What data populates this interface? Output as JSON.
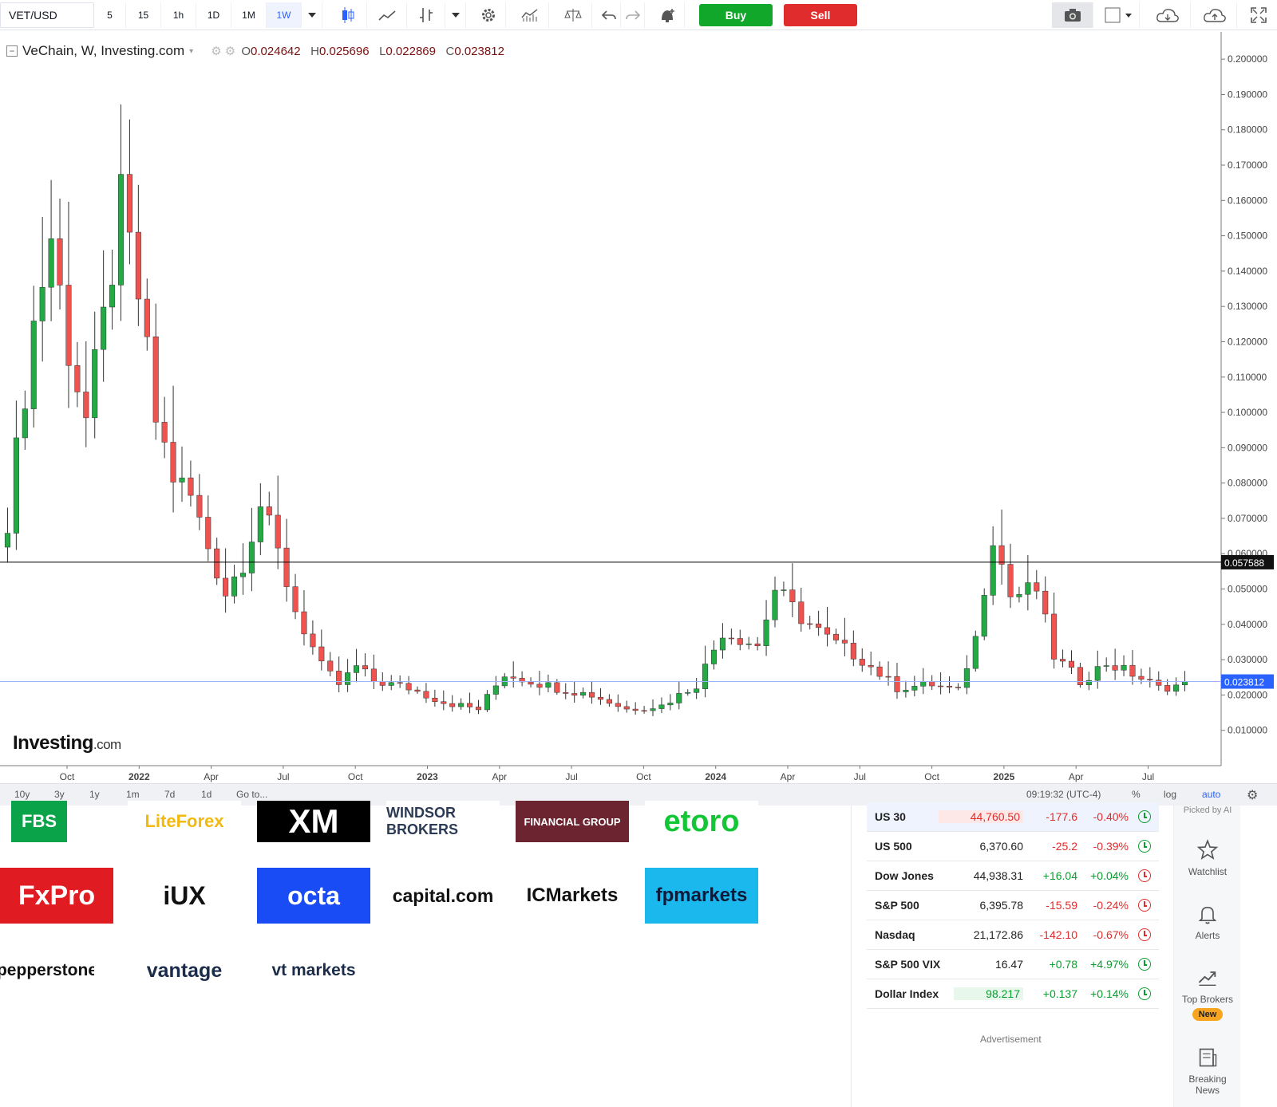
{
  "toolbar": {
    "symbol": "VET/USD",
    "intervals": [
      "5",
      "15",
      "1h",
      "1D",
      "1M",
      "1W"
    ],
    "active_interval": "1W",
    "buy_label": "Buy",
    "sell_label": "Sell"
  },
  "legend": {
    "title": "VeChain, W, Investing.com",
    "open_label": "O",
    "open": "0.024642",
    "high_label": "H",
    "high": "0.025696",
    "low_label": "L",
    "low": "0.022869",
    "close_label": "C",
    "close": "0.023812"
  },
  "chart_data": {
    "type": "candlestick",
    "title": "VeChain, W, Investing.com",
    "y_axis_ticks": [
      "0.200000",
      "0.190000",
      "0.180000",
      "0.170000",
      "0.160000",
      "0.150000",
      "0.140000",
      "0.130000",
      "0.120000",
      "0.110000",
      "0.100000",
      "0.090000",
      "0.080000",
      "0.070000",
      "0.060000",
      "0.050000",
      "0.040000",
      "0.030000",
      "0.020000",
      "0.010000"
    ],
    "ylim": [
      0.0,
      0.205
    ],
    "x_axis_ticks": [
      "Oct",
      "2022",
      "Apr",
      "Jul",
      "Oct",
      "2023",
      "Apr",
      "Jul",
      "Oct",
      "2024",
      "Apr",
      "Jul",
      "Oct",
      "2025",
      "Apr",
      "Jul"
    ],
    "horizontal_line": {
      "value": 0.057588,
      "label": "0.057588"
    },
    "last_price": {
      "value": 0.023812,
      "label": "0.023812"
    },
    "price_path": [
      [
        0,
        0.07
      ],
      [
        3,
        0.125
      ],
      [
        5,
        0.15
      ],
      [
        7,
        0.118
      ],
      [
        9,
        0.098
      ],
      [
        11,
        0.125
      ],
      [
        13,
        0.158
      ],
      [
        15,
        0.133
      ],
      [
        17,
        0.098
      ],
      [
        19,
        0.082
      ],
      [
        21,
        0.076
      ],
      [
        23,
        0.062
      ],
      [
        25,
        0.049
      ],
      [
        27,
        0.058
      ],
      [
        29,
        0.074
      ],
      [
        31,
        0.06
      ],
      [
        33,
        0.044
      ],
      [
        36,
        0.028
      ],
      [
        38,
        0.023
      ],
      [
        40,
        0.028
      ],
      [
        42,
        0.024
      ],
      [
        46,
        0.022
      ],
      [
        50,
        0.018
      ],
      [
        54,
        0.016
      ],
      [
        57,
        0.026
      ],
      [
        60,
        0.024
      ],
      [
        63,
        0.022
      ],
      [
        67,
        0.02
      ],
      [
        71,
        0.016
      ],
      [
        75,
        0.017
      ],
      [
        79,
        0.023
      ],
      [
        82,
        0.038
      ],
      [
        86,
        0.034
      ],
      [
        88,
        0.05
      ],
      [
        91,
        0.042
      ],
      [
        94,
        0.036
      ],
      [
        98,
        0.03
      ],
      [
        102,
        0.022
      ],
      [
        106,
        0.023
      ],
      [
        109,
        0.021
      ],
      [
        111,
        0.036
      ],
      [
        113,
        0.066
      ],
      [
        115,
        0.048
      ],
      [
        118,
        0.05
      ],
      [
        120,
        0.031
      ],
      [
        123,
        0.024
      ],
      [
        126,
        0.029
      ],
      [
        129,
        0.026
      ],
      [
        132,
        0.022
      ],
      [
        135,
        0.023
      ]
    ],
    "total_weeks": 136
  },
  "bottom_strip": {
    "ranges": [
      "10y",
      "3y",
      "1y",
      "1m",
      "7d",
      "1d"
    ],
    "goto": "Go to...",
    "time": "09:19:32 (UTC-4)",
    "pct": "%",
    "log": "log",
    "auto": "auto"
  },
  "brokers": [
    {
      "name": "FBS",
      "bg": "#0aa34a",
      "fg": "#ffffff"
    },
    {
      "name": "LiteForex",
      "bg": "#ffffff",
      "fg": "#f2b90f"
    },
    {
      "name": "XM",
      "bg": "#000000",
      "fg": "#ffffff"
    },
    {
      "name": "WINDSOR BROKERS",
      "bg": "#ffffff",
      "fg": "#2b3a55"
    },
    {
      "name": "FINANCIAL GROUP",
      "bg": "#6b2430",
      "fg": "#ffffff"
    },
    {
      "name": "etoro",
      "bg": "#ffffff",
      "fg": "#13c636"
    },
    {
      "name": "FxPro",
      "bg": "#e11b22",
      "fg": "#ffffff"
    },
    {
      "name": "iUX",
      "bg": "#ffffff",
      "fg": "#111111"
    },
    {
      "name": "octa",
      "bg": "#1a4cf5",
      "fg": "#ffffff"
    },
    {
      "name": "capital.com",
      "bg": "#ffffff",
      "fg": "#111111"
    },
    {
      "name": "ICMarkets",
      "bg": "#ffffff",
      "fg": "#111111"
    },
    {
      "name": "fpmarkets",
      "bg": "#1ab8ec",
      "fg": "#0d1a3a"
    },
    {
      "name": "pepperstone",
      "bg": "#ffffff",
      "fg": "#111111"
    },
    {
      "name": "vantage",
      "bg": "#ffffff",
      "fg": "#1b2b4a"
    },
    {
      "name": "vt markets",
      "bg": "#ffffff",
      "fg": "#1b2b4a"
    }
  ],
  "markets": [
    {
      "name": "US 30",
      "price": "44,760.50",
      "change": "-177.6",
      "pct": "-0.40%",
      "dir": "down",
      "clock": "up",
      "price_highlight": "#fde7e7",
      "row_highlight": "#eef3fd"
    },
    {
      "name": "US 500",
      "price": "6,370.60",
      "change": "-25.2",
      "pct": "-0.39%",
      "dir": "down",
      "clock": "up",
      "price_highlight": "",
      "row_highlight": ""
    },
    {
      "name": "Dow Jones",
      "price": "44,938.31",
      "change": "+16.04",
      "pct": "+0.04%",
      "dir": "up",
      "clock": "down",
      "price_highlight": "",
      "row_highlight": ""
    },
    {
      "name": "S&P 500",
      "price": "6,395.78",
      "change": "-15.59",
      "pct": "-0.24%",
      "dir": "down",
      "clock": "down",
      "price_highlight": "",
      "row_highlight": ""
    },
    {
      "name": "Nasdaq",
      "price": "21,172.86",
      "change": "-142.10",
      "pct": "-0.67%",
      "dir": "down",
      "clock": "down",
      "price_highlight": "",
      "row_highlight": ""
    },
    {
      "name": "S&P 500 VIX",
      "price": "16.47",
      "change": "+0.78",
      "pct": "+4.97%",
      "dir": "up",
      "clock": "up",
      "price_highlight": "",
      "row_highlight": ""
    },
    {
      "name": "Dollar Index",
      "price": "98.217",
      "change": "+0.137",
      "pct": "+0.14%",
      "dir": "up",
      "clock": "up",
      "price_highlight": "#e8f7ec",
      "row_highlight": ""
    }
  ],
  "advertisement": "Advertisement",
  "rail": {
    "picked": "Picked by AI",
    "watchlist": "Watchlist",
    "alerts": "Alerts",
    "top_brokers": "Top Brokers",
    "new_badge": "New",
    "breaking_news_1": "Breaking",
    "breaking_news_2": "News"
  },
  "colors": {
    "up": "#26a69a",
    "up_candle": "#22ab44",
    "down_candle": "#ef5350",
    "hline": "#000000",
    "last_line": "#2962ff"
  }
}
